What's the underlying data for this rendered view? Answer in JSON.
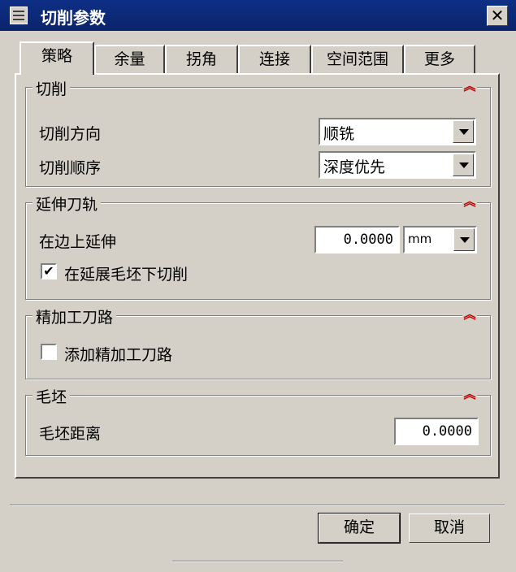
{
  "window": {
    "title": "切削参数",
    "close_glyph": "✕"
  },
  "tabs": [
    "策略",
    "余量",
    "拐角",
    "连接",
    "空间范围",
    "更多"
  ],
  "collapse_glyph": "︽",
  "groups": {
    "cutting": {
      "title": "切削",
      "direction_label": "切削方向",
      "direction_value": "顺铣",
      "order_label": "切削顺序",
      "order_value": "深度优先"
    },
    "extend": {
      "title": "延伸刀轨",
      "edge_extend_label": "在边上延伸",
      "edge_extend_value": "0.0000",
      "unit_value": "mm",
      "cut_below_label": "在延展毛坯下切削",
      "cut_below_checked": "✔"
    },
    "finish": {
      "title": "精加工刀路",
      "add_finish_label": "添加精加工刀路",
      "add_finish_checked": ""
    },
    "blank": {
      "title": "毛坯",
      "distance_label": "毛坯距离",
      "distance_value": "0.0000"
    }
  },
  "buttons": {
    "ok": "确定",
    "cancel": "取消"
  }
}
